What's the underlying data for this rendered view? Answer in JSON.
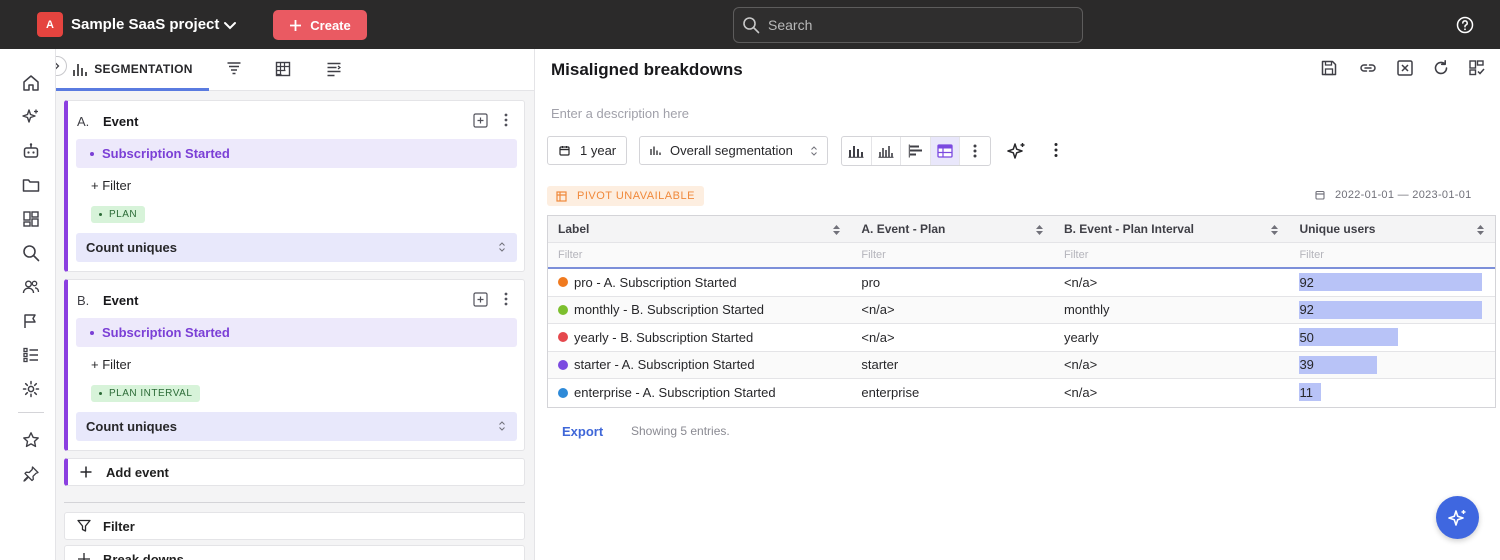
{
  "topbar": {
    "project_initial": "A",
    "project_name": "Sample SaaS project",
    "create_label": "Create",
    "search_placeholder": "Search"
  },
  "panel": {
    "tab_segmentation": "SEGMENTATION",
    "events": [
      {
        "letter": "A.",
        "title": "Event",
        "selected_event": "Subscription Started",
        "filter_label": "+ Filter",
        "breakdown_chip": "PLAN",
        "measure": "Count uniques"
      },
      {
        "letter": "B.",
        "title": "Event",
        "selected_event": "Subscription Started",
        "filter_label": "+ Filter",
        "breakdown_chip": "PLAN INTERVAL",
        "measure": "Count uniques"
      }
    ],
    "add_event_label": "Add event",
    "filter_label": "Filter",
    "breakdowns_label": "Break downs"
  },
  "main": {
    "title": "Misaligned breakdowns",
    "description_placeholder": "Enter a description here",
    "range_label": "1 year",
    "segmentation_select": "Overall segmentation",
    "pivot_badge": "PIVOT UNAVAILABLE",
    "date_range": "2022-01-01 — 2023-01-01",
    "table": {
      "headers": [
        "Label",
        "A. Event - Plan",
        "B. Event - Plan Interval",
        "Unique users"
      ],
      "filter_placeholder": "Filter",
      "max_value": 92,
      "rows": [
        {
          "label": "pro - A. Subscription Started",
          "plan": "pro",
          "interval": "<n/a>",
          "users": 92,
          "color": "#f07a1f"
        },
        {
          "label": "monthly - B. Subscription Started",
          "plan": "<n/a>",
          "interval": "monthly",
          "users": 92,
          "color": "#7cbf2e"
        },
        {
          "label": "yearly - B. Subscription Started",
          "plan": "<n/a>",
          "interval": "yearly",
          "users": 50,
          "color": "#e5484d"
        },
        {
          "label": "starter - A. Subscription Started",
          "plan": "starter",
          "interval": "<n/a>",
          "users": 39,
          "color": "#7b4ae0"
        },
        {
          "label": "enterprise - A. Subscription Started",
          "plan": "enterprise",
          "interval": "<n/a>",
          "users": 11,
          "color": "#2e8ad8"
        }
      ]
    },
    "export_label": "Export",
    "entries_text": "Showing 5 entries."
  },
  "colors": {
    "accent": "#8b3fe0",
    "create": "#ea5a62",
    "link": "#3f67d8",
    "bar": "#b8c3f7"
  }
}
